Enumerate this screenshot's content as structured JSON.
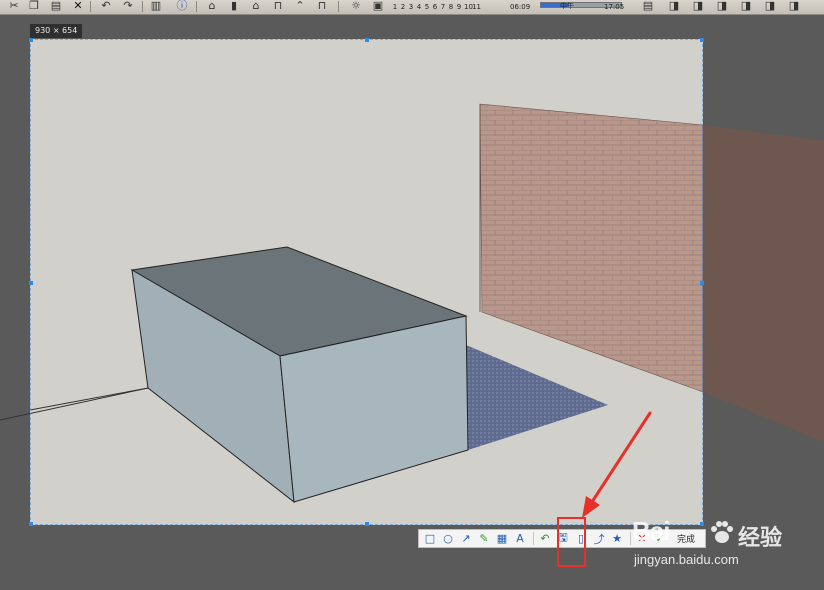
{
  "app_toolbar": {
    "scene_tabs": [
      "1",
      "2",
      "3",
      "4",
      "5",
      "6",
      "7",
      "8",
      "9",
      "10",
      "11"
    ],
    "time_start": "06:09",
    "time_mid": "中午",
    "time_end": "17:05",
    "icons": [
      "scissors-icon",
      "copy-icon",
      "paste-icon",
      "delete-icon",
      "undo-icon",
      "redo-icon",
      "print-icon",
      "info-icon",
      "house-icon",
      "door-icon",
      "window-icon",
      "roof-icon",
      "chair-icon",
      "model-info-icon",
      "sun-icon",
      "pages-icon"
    ]
  },
  "capture": {
    "size_label": "930 × 654",
    "toolbar": {
      "tools": [
        {
          "name": "rectangle-tool",
          "glyph": "□"
        },
        {
          "name": "ellipse-tool",
          "glyph": "○"
        },
        {
          "name": "arrow-tool",
          "glyph": "↗"
        },
        {
          "name": "pen-tool",
          "glyph": "✎"
        },
        {
          "name": "mosaic-tool",
          "glyph": "▦"
        },
        {
          "name": "text-tool",
          "glyph": "A"
        },
        {
          "name": "undo-tool",
          "glyph": "↶"
        },
        {
          "name": "save-tool",
          "glyph": "🖫"
        },
        {
          "name": "copy-tool",
          "glyph": "▯"
        },
        {
          "name": "share-tool",
          "glyph": "⤴"
        },
        {
          "name": "pin-tool",
          "glyph": "★"
        },
        {
          "name": "cancel-tool",
          "glyph": "✕"
        },
        {
          "name": "confirm-tool",
          "glyph": "✓"
        }
      ],
      "done_label": "完成"
    }
  },
  "watermark": {
    "logo": "Bai",
    "brand": "经验",
    "url": "jingyan.baidu.com"
  },
  "colors": {
    "sky": "#d1d0cb",
    "box_top": "#6b7478",
    "box_left": "#a1afb6",
    "box_front": "#a8b6bd",
    "wall": "#b8978a",
    "shadow": "#5e6b8f",
    "highlight": "#e8302a"
  }
}
